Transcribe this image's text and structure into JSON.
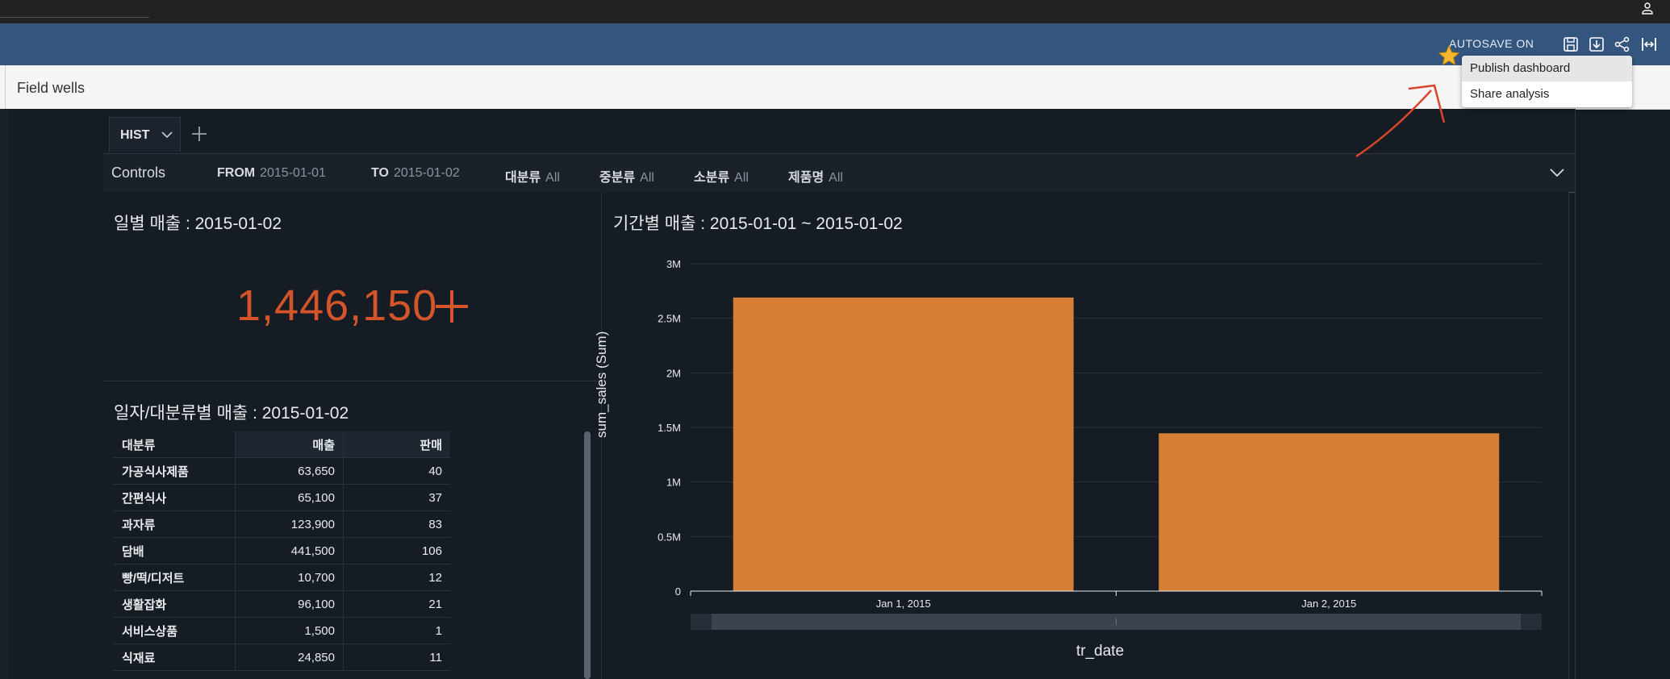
{
  "header": {
    "autosave_label": "AUTOSAVE ON"
  },
  "menu": {
    "items": [
      "Publish dashboard",
      "Share analysis"
    ]
  },
  "field_wells": {
    "label": "Field wells"
  },
  "sheet_tab": {
    "label": "HIST"
  },
  "controls": {
    "label": "Controls",
    "from": {
      "key": "FROM",
      "value": "2015-01-01"
    },
    "to": {
      "key": "TO",
      "value": "2015-01-02"
    },
    "cat_large": {
      "key": "대분류",
      "value": "All"
    },
    "cat_mid": {
      "key": "중분류",
      "value": "All"
    },
    "cat_small": {
      "key": "소분류",
      "value": "All"
    },
    "product": {
      "key": "제품명",
      "value": "All"
    }
  },
  "kpi_panel": {
    "title": "일별 매출 : 2015-01-02",
    "value": "1,446,150"
  },
  "table_panel": {
    "title": "일자/대분류별 매출 : 2015-01-02",
    "headers": [
      "대분류",
      "매출",
      "판매"
    ],
    "rows": [
      [
        "가공식사제품",
        "63,650",
        "40"
      ],
      [
        "간편식사",
        "65,100",
        "37"
      ],
      [
        "과자류",
        "123,900",
        "83"
      ],
      [
        "담배",
        "441,500",
        "106"
      ],
      [
        "빵/떡/디저트",
        "10,700",
        "12"
      ],
      [
        "생활잡화",
        "96,100",
        "21"
      ],
      [
        "서비스상품",
        "1,500",
        "1"
      ],
      [
        "식재료",
        "24,850",
        "11"
      ]
    ]
  },
  "chart_panel": {
    "title": "기간별 매출 : 2015-01-01 ~ 2015-01-02"
  },
  "chart_data": {
    "type": "bar",
    "categories": [
      "Jan 1, 2015",
      "Jan 2, 2015"
    ],
    "values": [
      2690000,
      1446150
    ],
    "xlabel": "tr_date",
    "ylabel": "sum_sales (Sum)",
    "ylim": [
      0,
      3000000
    ],
    "yticks": [
      {
        "value": 0,
        "label": "0"
      },
      {
        "value": 500000,
        "label": "0.5M"
      },
      {
        "value": 1000000,
        "label": "1M"
      },
      {
        "value": 1500000,
        "label": "1.5M"
      },
      {
        "value": 2000000,
        "label": "2M"
      },
      {
        "value": 2500000,
        "label": "2.5M"
      },
      {
        "value": 3000000,
        "label": "3M"
      }
    ],
    "bar_color": "#d67d36",
    "grid": true
  },
  "colors": {
    "header_bg": "#34557e",
    "kpi": "#d4552a",
    "annotation_arrow": "#d9462a"
  },
  "icons": [
    "user-icon",
    "save-icon",
    "download-icon",
    "share-icon",
    "fit-width-icon",
    "star-icon",
    "chevron-down-icon",
    "plus-icon"
  ]
}
